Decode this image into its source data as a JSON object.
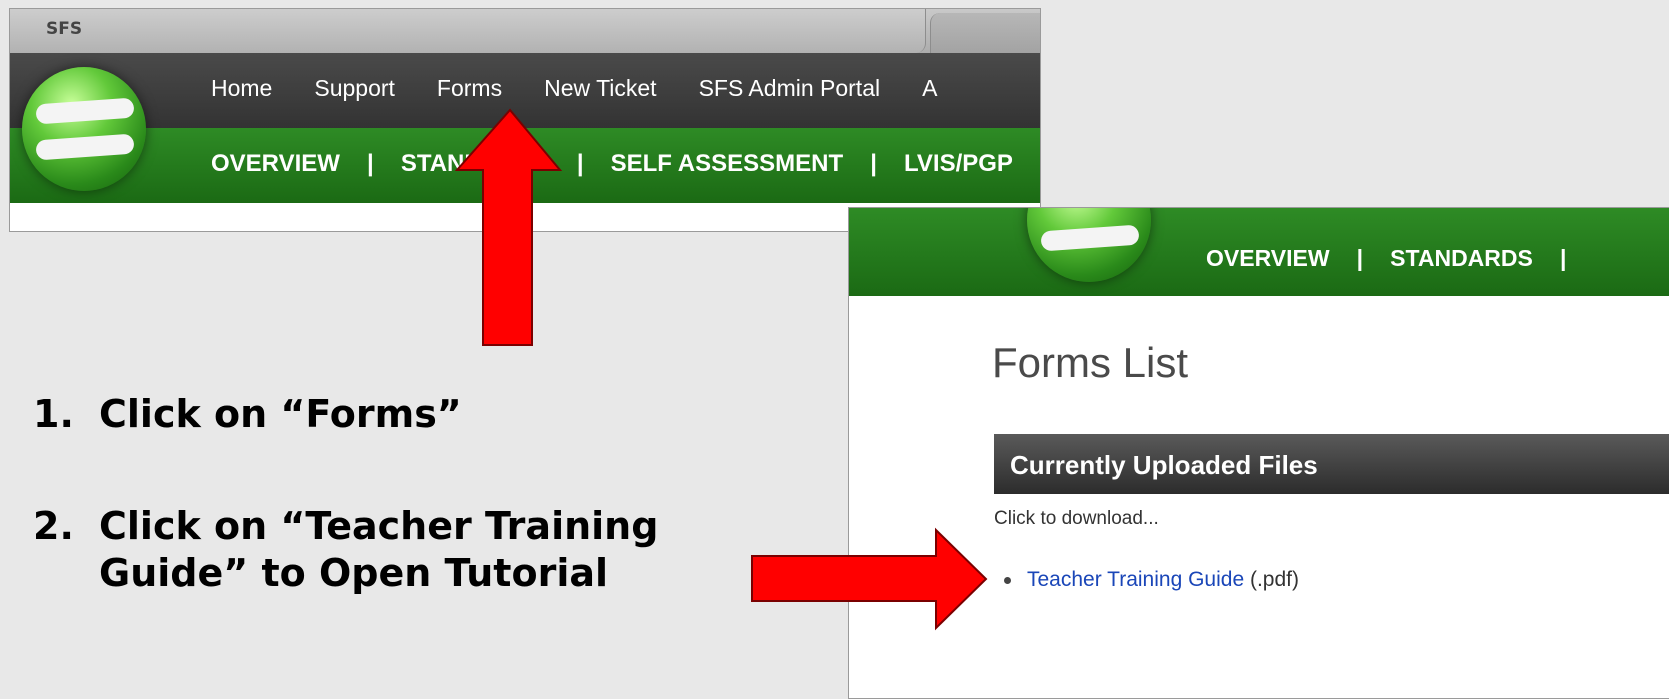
{
  "screenshot1": {
    "tab_label": "SFS",
    "nav_primary": [
      "Home",
      "Support",
      "Forms",
      "New Ticket",
      "SFS Admin Portal",
      "A"
    ],
    "nav_secondary": [
      "OVERVIEW",
      "STANDARDS",
      "SELF ASSESSMENT",
      "LVIS/PGP"
    ],
    "separator": "|"
  },
  "screenshot2": {
    "nav_secondary": [
      "OVERVIEW",
      "STANDARDS"
    ],
    "separator": "|",
    "page_title": "Forms List",
    "section_title": "Currently Uploaded Files",
    "hint": "Click to download...",
    "file_link": "Teacher Training Guide",
    "file_ext": "(.pdf)"
  },
  "instructions": {
    "step1_num": "1.",
    "step1_text": "Click on “Forms”",
    "step2_num": "2.",
    "step2_line1": "Click on “Teacher Training",
    "step2_line2": "Guide” to Open Tutorial"
  },
  "colors": {
    "arrow": "#ff0000",
    "nav_green": "#1f7318",
    "nav_dark": "#3a3a3a",
    "link": "#1a46b8"
  }
}
